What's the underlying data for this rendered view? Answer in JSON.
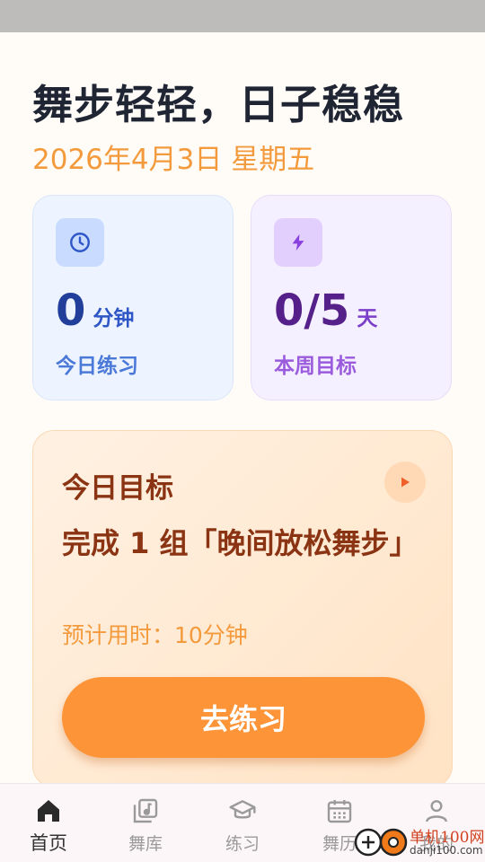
{
  "header": {
    "title": "舞步轻轻，日子稳稳",
    "date": "2026年4月3日 星期五"
  },
  "stats": {
    "today": {
      "value": "0",
      "unit": "分钟",
      "label": "今日练习",
      "icon": "clock-icon"
    },
    "week": {
      "value": "0/5",
      "unit": "天",
      "label": "本周目标",
      "icon": "lightning-icon"
    }
  },
  "goal": {
    "title": "今日目标",
    "task": "完成 1 组「晚间放松舞步」",
    "estimate": "预计用时：10分钟",
    "button": "去练习"
  },
  "tabs": [
    {
      "label": "首页",
      "icon": "home-icon",
      "active": true
    },
    {
      "label": "舞库",
      "icon": "music-library-icon",
      "active": false
    },
    {
      "label": "练习",
      "icon": "graduation-cap-icon",
      "active": false
    },
    {
      "label": "舞历",
      "icon": "calendar-icon",
      "active": false
    },
    {
      "label": "我的",
      "icon": "user-icon",
      "active": false
    }
  ],
  "watermark": {
    "title": "单机100网",
    "url": "danji100.com"
  },
  "colors": {
    "accent": "#fd9437",
    "blue_card": "#edf4ff",
    "purple_card": "#f4f0ff",
    "goal_text": "#8b3413"
  }
}
